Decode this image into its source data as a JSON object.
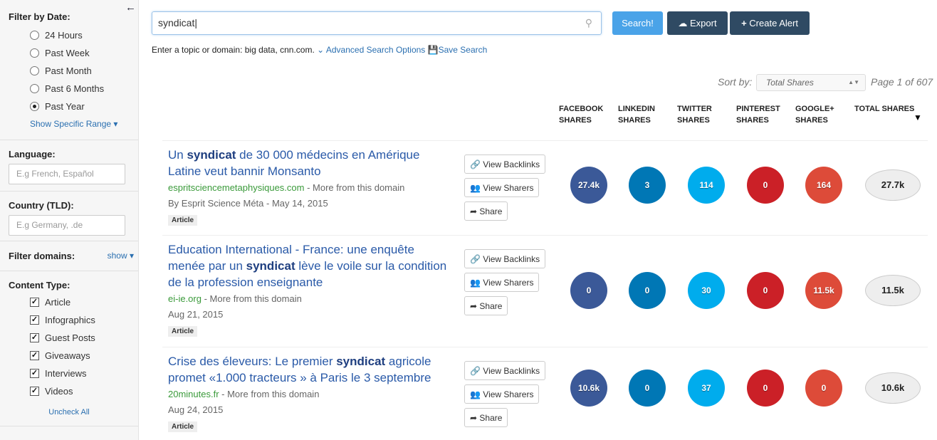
{
  "sidebar": {
    "date": {
      "title": "Filter by Date:",
      "options": [
        "24 Hours",
        "Past Week",
        "Past Month",
        "Past 6 Months",
        "Past Year"
      ],
      "selected": "Past Year",
      "range_link": "Show Specific Range"
    },
    "language": {
      "title": "Language:",
      "placeholder": "E.g French, Español"
    },
    "country": {
      "title": "Country (TLD):",
      "placeholder": "E.g Germany, .de"
    },
    "domains": {
      "title": "Filter domains:",
      "show": "show"
    },
    "content": {
      "title": "Content Type:",
      "items": [
        "Article",
        "Infographics",
        "Guest Posts",
        "Giveaways",
        "Interviews",
        "Videos"
      ],
      "uncheck": "Uncheck All"
    }
  },
  "search": {
    "value": "syndicat",
    "button": "Search!",
    "export": "Export",
    "alert": "Create Alert",
    "hint": "Enter a topic or domain: big data, cnn.com.",
    "advanced": "Advanced Search Options",
    "save": "Save Search"
  },
  "sort": {
    "label": "Sort by:",
    "value": "Total Shares",
    "page": "Page 1 of 607"
  },
  "columns": [
    "FACEBOOK SHARES",
    "LINKEDIN SHARES",
    "TWITTER SHARES",
    "PINTEREST SHARES",
    "GOOGLE+ SHARES",
    "TOTAL SHARES"
  ],
  "colors": {
    "facebook": "#3b5998",
    "linkedin": "#0077b5",
    "twitter": "#00aced",
    "pinterest": "#cb2027",
    "google": "#dd4b39",
    "search_btn": "#4aa3e8",
    "dark_btn": "#2f4a63"
  },
  "actions": {
    "backlinks": "View Backlinks",
    "sharers": "View Sharers",
    "share": "Share",
    "more": " - More from this domain"
  },
  "results": [
    {
      "pre": "Un ",
      "kw": "syndicat",
      "post": " de 30 000 médecins en Amérique Latine veut bannir Monsanto",
      "domain": "espritsciencemetaphysiques.com",
      "byline": "By Esprit Science Méta - May 14, 2015",
      "tag": "Article",
      "shares": [
        "27.4k",
        "3",
        "114",
        "0",
        "164",
        "27.7k"
      ]
    },
    {
      "pre": "Education International - France: une enquête menée par un ",
      "kw": "syndicat",
      "post": " lève le voile sur la condition de la profession enseignante",
      "domain": "ei-ie.org",
      "byline": "Aug 21, 2015",
      "tag": "Article",
      "shares": [
        "0",
        "0",
        "30",
        "0",
        "11.5k",
        "11.5k"
      ]
    },
    {
      "pre": "Crise des éleveurs: Le premier ",
      "kw": "syndicat",
      "post": " agricole promet «1.000 tracteurs » à Paris le 3 septembre",
      "domain": "20minutes.fr",
      "byline": "Aug 24, 2015",
      "tag": "Article",
      "shares": [
        "10.6k",
        "0",
        "37",
        "0",
        "0",
        "10.6k"
      ]
    }
  ]
}
